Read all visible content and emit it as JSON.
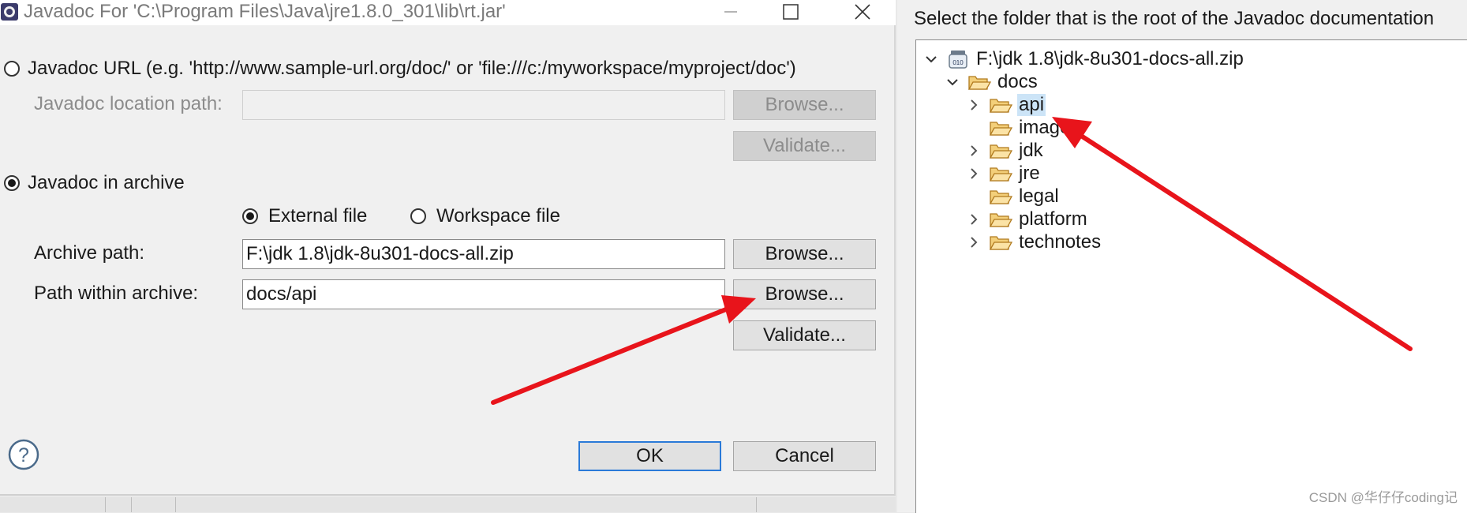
{
  "dialog": {
    "title": "Javadoc For 'C:\\Program Files\\Java\\jre1.8.0_301\\lib\\rt.jar'",
    "url_radio_label": "Javadoc URL (e.g. 'http://www.sample-url.org/doc/' or 'file:///c:/myworkspace/myproject/doc')",
    "location_label": "Javadoc location path:",
    "location_value": "",
    "browse_label": "Browse...",
    "validate_label": "Validate...",
    "archive_radio_label": "Javadoc in archive",
    "external_file_label": "External file",
    "workspace_file_label": "Workspace file",
    "archive_path_label": "Archive path:",
    "archive_path_value": "F:\\jdk 1.8\\jdk-8u301-docs-all.zip",
    "path_within_label": "Path within archive:",
    "path_within_value": "docs/api",
    "ok_label": "OK",
    "cancel_label": "Cancel"
  },
  "folder_dialog": {
    "instruction": "Select the folder that is the root of the Javadoc documentation",
    "tree": {
      "root": "F:\\jdk 1.8\\jdk-8u301-docs-all.zip",
      "docs": "docs",
      "children": [
        "api",
        "images",
        "jdk",
        "jre",
        "legal",
        "platform",
        "technotes"
      ]
    }
  },
  "watermark": "CSDN @华仔仔coding记",
  "colors": {
    "annotation_arrow": "#e8141b",
    "selection": "#cce4f7",
    "default_button_border": "#2a7ad8"
  }
}
